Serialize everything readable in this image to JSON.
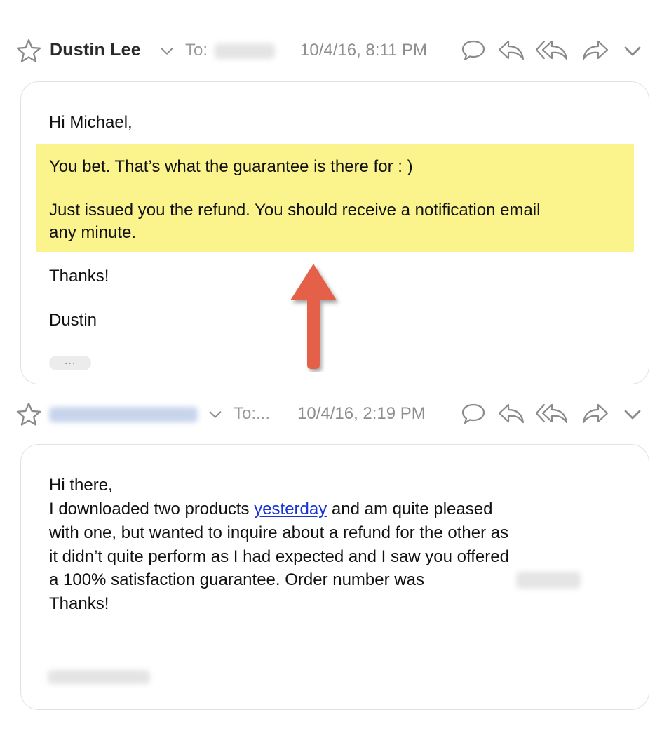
{
  "messages": [
    {
      "sender": "Dustin Lee",
      "to_label": "To:",
      "date": "10/4/16, 8:11 PM",
      "body": {
        "greeting": "Hi Michael,",
        "line1": "You bet. That’s what the guarantee is there for : )",
        "line2a": "Just issued you the refund. You should receive a notification email",
        "line2b": "any minute.",
        "thanks": "Thanks!",
        "signature": "Dustin"
      },
      "collapsed_quote": "..."
    },
    {
      "to_label": "To:...",
      "date": "10/4/16, 2:19 PM",
      "body": {
        "greeting": "Hi there,",
        "l1_pre": "I downloaded two products ",
        "l1_link": "yesterday",
        "l1_post": " and am quite pleased",
        "l2": "with one, but wanted to inquire about a refund for the other as",
        "l3": "it didn’t quite perform as I had expected and I saw you offered",
        "l4": "a 100% satisfaction guarantee. Order number was",
        "thanks": "Thanks!"
      }
    }
  ],
  "colors": {
    "highlight": "#fbf48c",
    "arrow": "#e4604a",
    "link": "#1a31d6"
  },
  "icons": [
    "star-icon",
    "chevron-down-icon",
    "reply-bubble-icon",
    "reply-icon",
    "reply-all-icon",
    "forward-icon",
    "more-chevron-icon"
  ]
}
